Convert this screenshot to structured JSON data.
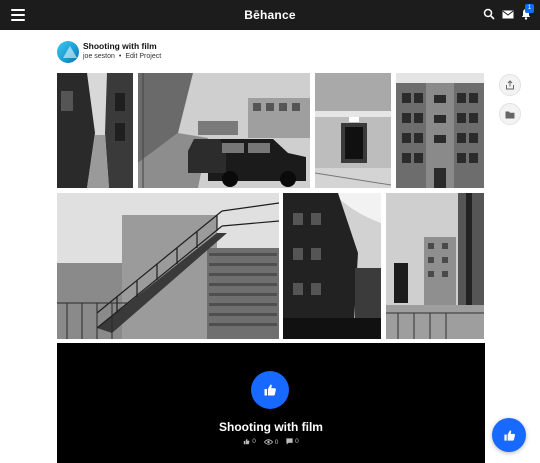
{
  "topbar": {
    "brand": "Bēhance",
    "notification_count": "1",
    "icons": [
      "menu-icon",
      "search-icon",
      "mail-icon",
      "bell-icon"
    ]
  },
  "project": {
    "title": "Shooting with film",
    "owner": "joe seston",
    "separator": "•",
    "edit_label": "Edit Project"
  },
  "side_actions": [
    "share-icon",
    "folder-icon"
  ],
  "footer": {
    "title": "Shooting with film",
    "appreciations": "0",
    "views": "0",
    "comments": "0"
  },
  "colors": {
    "topbar": "#1c1c1c",
    "accent": "#1769ff",
    "page_bg": "#ffffff",
    "footer_bg": "#000000"
  }
}
